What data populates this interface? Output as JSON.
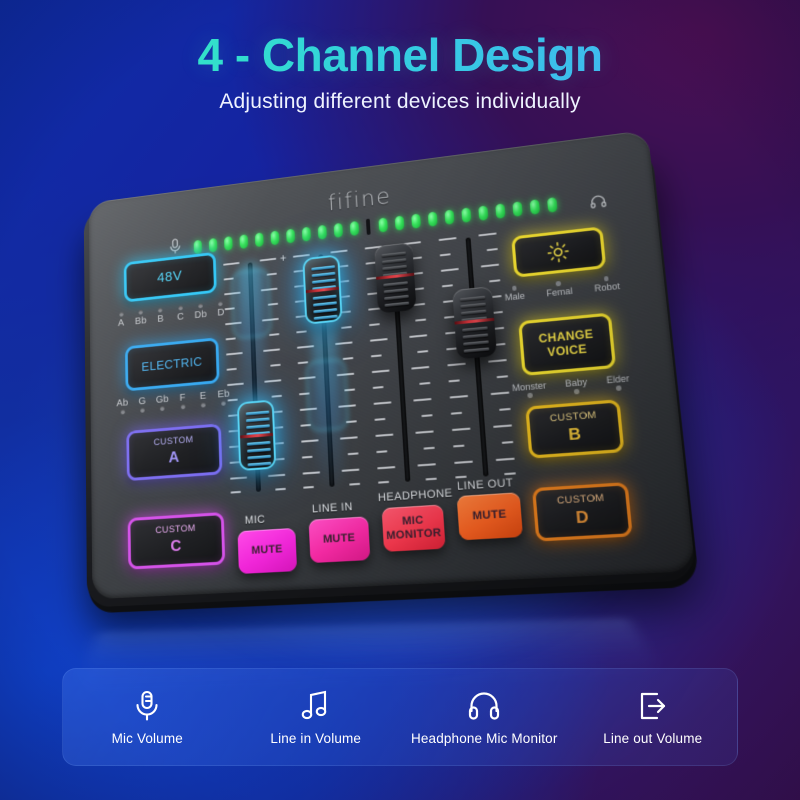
{
  "header": {
    "title": "4 - Channel Design",
    "subtitle": "Adjusting different devices individually"
  },
  "device": {
    "brand": "fifine",
    "meter": {
      "mic_icon": "microphone-icon",
      "headphone_icon": "headphone-icon",
      "left_leds": 11,
      "right_leds": 11,
      "led_color": "#35e05a"
    },
    "left_buttons": [
      {
        "name": "48v-button",
        "label": "48V",
        "accent": "#2fc6f5"
      },
      {
        "name": "electric-button",
        "label": "ELECTRIC",
        "accent": "#35a8f0"
      },
      {
        "name": "custom-a-button",
        "sub": "CUSTOM",
        "big": "A",
        "accent": "#7b6cf0"
      },
      {
        "name": "custom-c-button",
        "sub": "CUSTOM",
        "big": "C",
        "accent": "#d451e8"
      }
    ],
    "notes_top": [
      "A",
      "Bb",
      "B",
      "C",
      "Db",
      "D"
    ],
    "notes_bottom": [
      "Ab",
      "G",
      "Gb",
      "F",
      "E",
      "Eb"
    ],
    "right_buttons": [
      {
        "name": "brightness-button",
        "icon": "sun-icon",
        "accent": "#f5e231"
      },
      {
        "name": "change-voice-button",
        "line1": "CHANGE",
        "line2": "VOICE",
        "accent": "#f5e231"
      },
      {
        "name": "custom-b-button",
        "sub": "CUSTOM",
        "big": "B",
        "accent": "#f0c120"
      },
      {
        "name": "custom-d-button",
        "sub": "CUSTOM",
        "big": "D",
        "accent": "#f0841f"
      }
    ],
    "voice_top": [
      "Male",
      "Femal",
      "Robot"
    ],
    "voice_bottom": [
      "Monster",
      "Baby",
      "Elder"
    ],
    "fader_scale_plus": "+",
    "channels": [
      {
        "name": "mic",
        "label": "MIC"
      },
      {
        "name": "line-in",
        "label": "LINE IN"
      },
      {
        "name": "headphone",
        "label": "HEADPHONE"
      },
      {
        "name": "line-out",
        "label": "LINE OUT"
      }
    ],
    "mute_buttons": [
      {
        "name": "mic-mute-button",
        "text": "MUTE",
        "color": "#f026d8"
      },
      {
        "name": "line-in-mute-button",
        "text": "MUTE",
        "color": "#f92aa6"
      },
      {
        "name": "headphone-monitor-button",
        "text": "MIC\nMONITOR",
        "color": "#fb3a50"
      },
      {
        "name": "line-out-mute-button",
        "text": "MUTE",
        "color": "#fb6322"
      }
    ]
  },
  "features": [
    {
      "icon": "microphone-icon",
      "label": "Mic Volume"
    },
    {
      "icon": "music-note-icon",
      "label": "Line in Volume"
    },
    {
      "icon": "headphone-icon",
      "label": "Headphone Mic Monitor"
    },
    {
      "icon": "exit-arrow-icon",
      "label": "Line out Volume"
    }
  ],
  "colors": {
    "accent_title_start": "#3fecb4",
    "accent_title_end": "#4fb2f2",
    "background_blue": "#0e2ea8",
    "background_purple": "#3a1152"
  }
}
